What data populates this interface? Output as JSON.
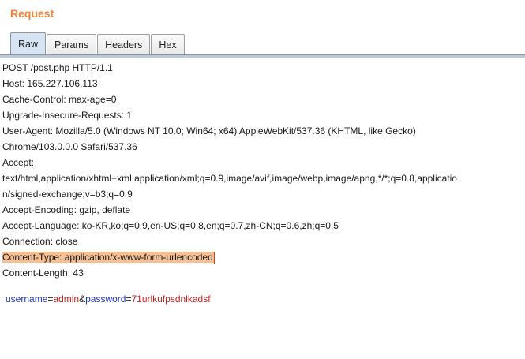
{
  "panel": {
    "title": "Request"
  },
  "tabs": [
    {
      "label": "Raw",
      "active": true
    },
    {
      "label": "Params",
      "active": false
    },
    {
      "label": "Headers",
      "active": false
    },
    {
      "label": "Hex",
      "active": false
    }
  ],
  "request_lines": [
    "POST /post.php HTTP/1.1",
    "Host: 165.227.106.113",
    "Cache-Control: max-age=0",
    "Upgrade-Insecure-Requests: 1",
    "User-Agent: Mozilla/5.0 (Windows NT 10.0; Win64; x64) AppleWebKit/537.36 (KHTML, like Gecko)",
    "Chrome/103.0.0.0 Safari/537.36",
    "Accept:",
    "text/html,application/xhtml+xml,application/xml;q=0.9,image/avif,image/webp,image/apng,*/*;q=0.8,applicatio",
    "n/signed-exchange;v=b3;q=0.9",
    "Accept-Encoding: gzip, deflate",
    "Accept-Language: ko-KR,ko;q=0.9,en-US;q=0.8,en;q=0.7,zh-CN;q=0.6,zh;q=0.5",
    "Connection: close",
    "Content-Type: application/x-www-form-urlencoded",
    "Content-Length: 43"
  ],
  "highlighted_line_index": 12,
  "body_params": {
    "p1_name": "username",
    "eq1": "=",
    "p1_value": "admin",
    "amp": "&",
    "p2_name": "password",
    "eq2": "=",
    "p2_value": "71urlkufpsdnlkadsf"
  },
  "colors": {
    "title": "#f0843c",
    "param_name": "#2233cc",
    "param_value": "#cc2222",
    "highlight": "#f7bf92"
  }
}
